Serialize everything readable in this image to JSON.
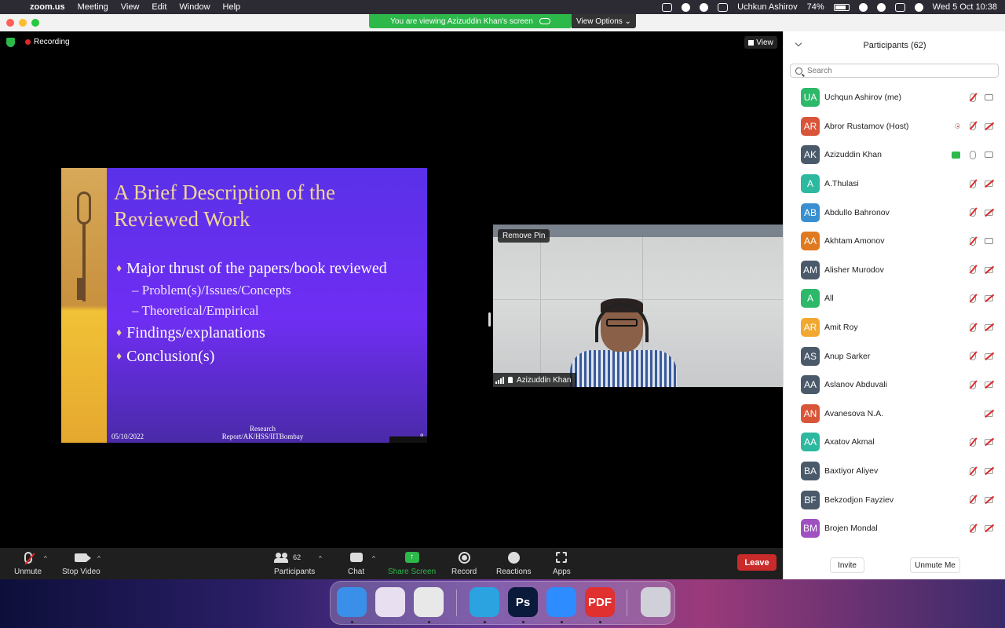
{
  "menubar": {
    "app_name": "zoom.us",
    "menus": [
      "Meeting",
      "View",
      "Edit",
      "Window",
      "Help"
    ],
    "user_name": "Uchkun Ashirov",
    "battery": "74%",
    "clock": "Wed 5 Oct  10:38"
  },
  "window": {
    "viewing_banner": "You are viewing Azizuddin Khan's screen",
    "view_options": "View Options",
    "recording_label": "Recording",
    "view_button": "View"
  },
  "slide": {
    "title_line1": "A Brief Description of the",
    "title_line2": "Reviewed Work",
    "bullets": [
      "Major thrust of the papers/book reviewed",
      "Problem(s)/Issues/Concepts",
      "Theoretical/Empirical",
      "Findings/explanations",
      "Conclusion(s)"
    ],
    "footer_date": "05/10/2022",
    "footer_center_line1": "Research",
    "footer_center_line2": "Report/AK/HSS/IITBombay",
    "footer_page": "8",
    "controls_glyph": "≡ ▴ ✕"
  },
  "video": {
    "remove_pin": "Remove Pin",
    "name": "Azizuddin Khan"
  },
  "toolbar": {
    "unmute": "Unmute",
    "stop_video": "Stop Video",
    "participants": "Participants",
    "participants_count": "62",
    "chat": "Chat",
    "share_screen": "Share Screen",
    "record": "Record",
    "reactions": "Reactions",
    "apps": "Apps",
    "leave": "Leave",
    "caret": "^",
    "share_arrow": "↑"
  },
  "panel": {
    "title": "Participants (62)",
    "search_placeholder": "Search",
    "invite": "Invite",
    "unmute_me": "Unmute Me",
    "participants": [
      {
        "initials": "UA",
        "name": "Uchqun Ashirov (me)",
        "color": "#2db86a",
        "mic": "off",
        "cam": "on"
      },
      {
        "initials": "AR",
        "name": "Abror Rustamov (Host)",
        "color": "#d9553a",
        "mic": "off",
        "cam": "off",
        "rec": true
      },
      {
        "initials": "AK",
        "name": "Azizuddin Khan",
        "color": "#4a5a6a",
        "mic": "on",
        "cam": "on",
        "share": true
      },
      {
        "initials": "A",
        "name": "A.Thulasi",
        "color": "#2db8a0",
        "mic": "off",
        "cam": "off"
      },
      {
        "initials": "AB",
        "name": "Abdullo Bahronov",
        "color": "#3a8fd0",
        "mic": "off",
        "cam": "off"
      },
      {
        "initials": "AA",
        "name": "Akhtam Amonov",
        "color": "#e07a20",
        "mic": "off",
        "cam": "on"
      },
      {
        "initials": "AM",
        "name": "Alisher Murodov",
        "color": "#4a5a6a",
        "mic": "off",
        "cam": "off"
      },
      {
        "initials": "A",
        "name": "All",
        "color": "#2db86a",
        "mic": "off",
        "cam": "off"
      },
      {
        "initials": "AR",
        "name": "Amit Roy",
        "color": "#f0a830",
        "mic": "off",
        "cam": "off"
      },
      {
        "initials": "AS",
        "name": "Anup Sarker",
        "color": "#4a5a6a",
        "mic": "off",
        "cam": "off"
      },
      {
        "initials": "AA",
        "name": "Aslanov Abduvali",
        "color": "#4a5a6a",
        "mic": "off",
        "cam": "off"
      },
      {
        "initials": "AN",
        "name": "Avanesova N.A.",
        "color": "#d9553a",
        "mic": "none",
        "cam": "off"
      },
      {
        "initials": "AA",
        "name": "Axatov Akmal",
        "color": "#2db8a0",
        "mic": "off",
        "cam": "off"
      },
      {
        "initials": "BA",
        "name": "Baxtiyor Aliyev",
        "color": "#4a5a6a",
        "mic": "off",
        "cam": "off"
      },
      {
        "initials": "BF",
        "name": "Bekzodjon Fayziev",
        "color": "#4a5a6a",
        "mic": "off",
        "cam": "off"
      },
      {
        "initials": "BM",
        "name": "Brojen Mondal",
        "color": "#a050c0",
        "mic": "off",
        "cam": "off"
      }
    ]
  },
  "dock": {
    "apps": [
      {
        "name": "Finder",
        "glyph": "",
        "color": "#3a8fe8"
      },
      {
        "name": "Launchpad",
        "glyph": "",
        "color": "#e8e0f0"
      },
      {
        "name": "Chrome",
        "glyph": "",
        "color": "#e8e8e8"
      },
      {
        "name": "Telegram",
        "glyph": "",
        "color": "#2aa3e0"
      },
      {
        "name": "Photoshop",
        "glyph": "Ps",
        "color": "#0a1a3a"
      },
      {
        "name": "Zoom",
        "glyph": "",
        "color": "#2d8cff"
      },
      {
        "name": "PDF Expert",
        "glyph": "PDF",
        "color": "#e03030"
      },
      {
        "name": "Trash",
        "glyph": "",
        "color": "#d0d0d8"
      }
    ]
  }
}
